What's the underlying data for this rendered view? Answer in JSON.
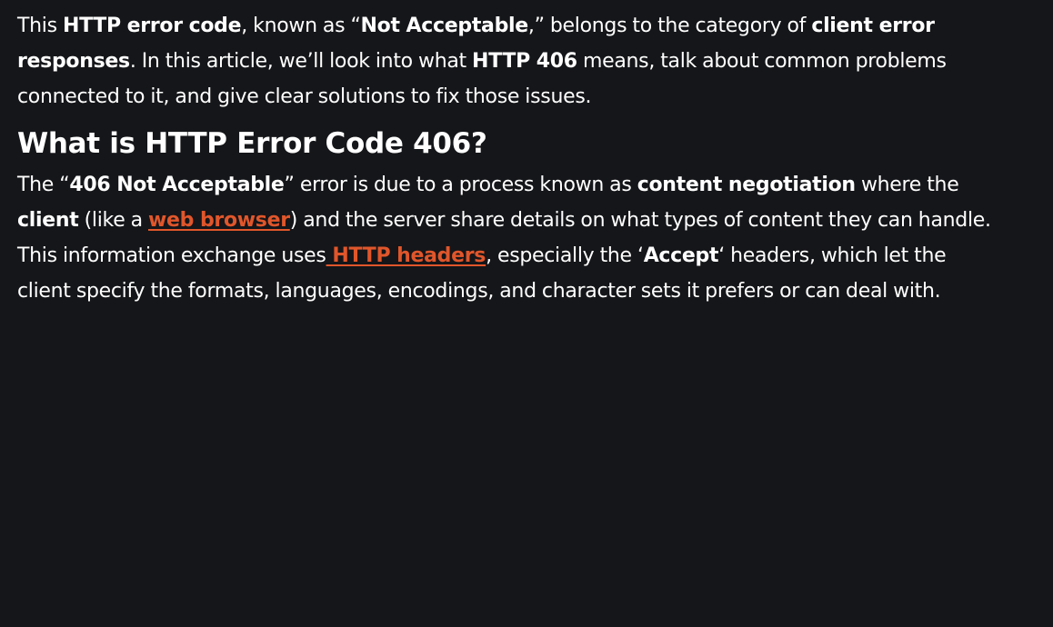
{
  "intro": {
    "s1": "This ",
    "b1": "HTTP error code",
    "s2": ", known as “",
    "b2": "Not Acceptable",
    "s3": ",” belongs to the category of ",
    "b3": "client error responses",
    "s4": ". In this article, we’ll look into what ",
    "b4": "HTTP 406",
    "s5": " means, talk about common problems connected to it, and give clear solutions to fix those issues."
  },
  "section": {
    "heading": "What is HTTP Error Code 406?"
  },
  "body": {
    "s1": "The “",
    "b1": "406 Not Acceptable",
    "s2": "” error is due to a process known as ",
    "b2": "content negotiation",
    "s3": " where the ",
    "b3": "client",
    "s4": " (like a ",
    "link1": "web browser",
    "s5": ") and the server share details on what types of content they can handle. This information exchange uses",
    "link2": " HTTP headers",
    "s6": ", especially the ‘",
    "b4": "Accept",
    "s7": "‘ headers, which let the client specify the formats, languages, encodings, and character sets it prefers or can deal with."
  },
  "colors": {
    "background": "#151619",
    "text": "#ffffff",
    "link": "#e0562b"
  }
}
